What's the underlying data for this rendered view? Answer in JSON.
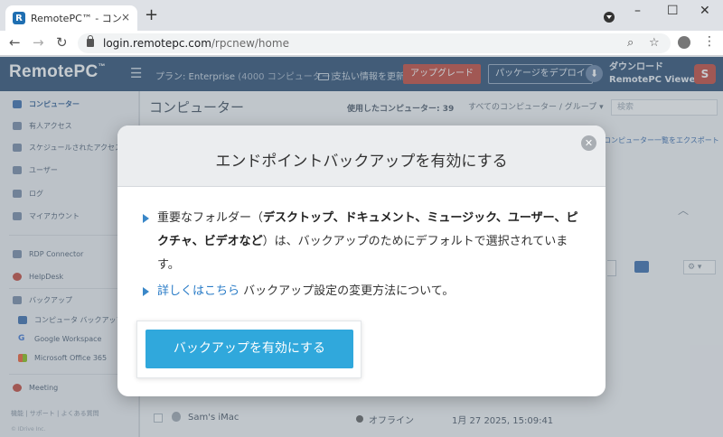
{
  "browser": {
    "tab_title": "RemotePC™ - コンピューター",
    "tab_favicon": "R",
    "url_host": "login.remotepc.com",
    "url_path": "/rpcnew/home",
    "new_tab_icon": "+",
    "close_tab_icon": "×"
  },
  "header": {
    "logo": "RemotePC",
    "plan_label": "プラン: Enterprise",
    "plan_detail": "(4000 コンピューター)",
    "billing_label": "支払い情報を更新",
    "upgrade_label": "アップグレード",
    "deploy_label": "パッケージをデプロイ",
    "download_line1": "ダウンロード",
    "download_line2": "RemotePC Viewer",
    "avatar_initial": "S"
  },
  "sidebar": {
    "items": [
      {
        "label": "コンピューター"
      },
      {
        "label": "有人アクセス"
      },
      {
        "label": "スケジュールされたアクセス"
      },
      {
        "label": "ユーザー"
      },
      {
        "label": "ログ"
      },
      {
        "label": "マイアカウント"
      },
      {
        "label": "RDP Connector"
      },
      {
        "label": "HelpDesk"
      },
      {
        "label": "バックアップ"
      },
      {
        "label": "コンピュータ バックアップ"
      },
      {
        "label": "Google Workspace"
      },
      {
        "label": "Microsoft Office 365"
      },
      {
        "label": "Meeting"
      }
    ],
    "footer_links": "機能  |  サポート  |  よくある質問",
    "copyright": "© IDrive Inc."
  },
  "main": {
    "title": "コンピューター",
    "used_count": "使用したコンピューター: 39",
    "group_select": "すべてのコンピューター / グループ",
    "search_placeholder": "検索",
    "export_link": "コンピューター一覧をエクスポート",
    "row": {
      "name": "Sam's iMac",
      "status": "オフライン",
      "last_seen": "1月 27 2025, 15:09:41"
    }
  },
  "modal": {
    "title": "エンドポイントバックアップを有効にする",
    "bullet1_prefix": "重要なフォルダー（",
    "bullet1_bold": "デスクトップ、ドキュメント、ミュージック、ユーザー、ピクチャ、ビデオなど",
    "bullet1_suffix": "）は、バックアップのためにデフォルトで選択されています。",
    "bullet2_link": "詳しくはこちら",
    "bullet2_suffix": " バックアップ設定の変更方法について。",
    "cta_label": "バックアップを有効にする"
  }
}
